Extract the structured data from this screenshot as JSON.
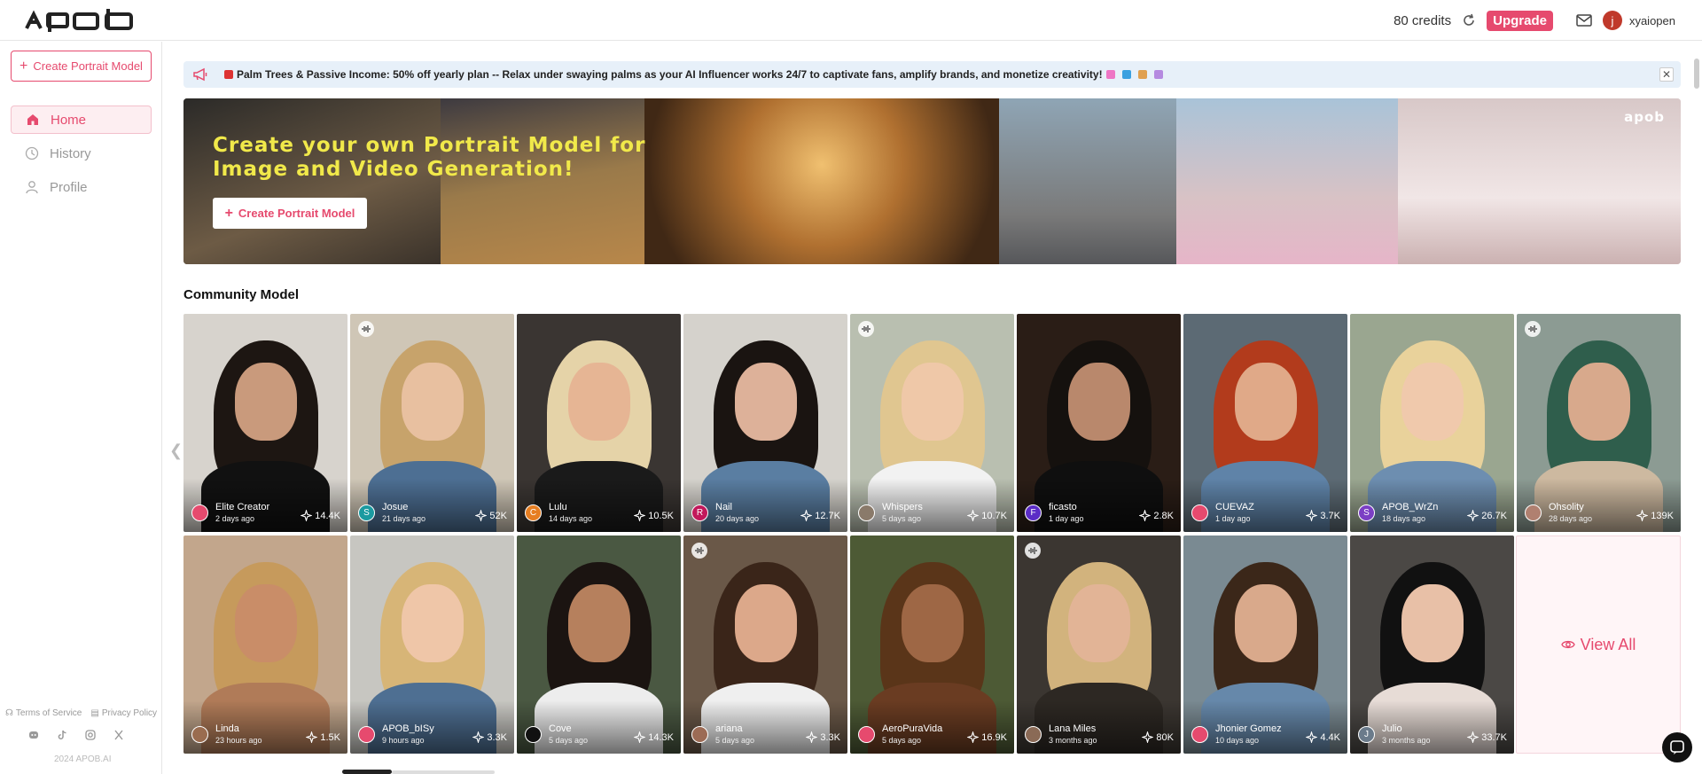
{
  "header": {
    "logo": "apob",
    "credits": "80 credits",
    "upgrade": "Upgrade",
    "avatar_letter": "j",
    "username": "xyaiopen"
  },
  "sidebar": {
    "create_label": "Create Portrait Model",
    "items": [
      {
        "label": "Home",
        "icon": "home-icon",
        "active": true
      },
      {
        "label": "History",
        "icon": "clock-icon",
        "active": false
      },
      {
        "label": "Profile",
        "icon": "user-icon",
        "active": false
      }
    ],
    "terms": "Terms of Service",
    "privacy": "Privacy Policy",
    "copyright": "2024 APOB.AI"
  },
  "announcement": {
    "text": "Palm Trees & Passive Income: 50% off yearly plan -- Relax under swaying palms as your AI Influencer works 24/7 to captivate fans, amplify brands, and monetize creativity!"
  },
  "banner": {
    "title_line1": "Create your own Portrait Model for",
    "title_line2": "Image and Video Generation!",
    "button": "Create Portrait Model",
    "logo": "apob"
  },
  "community": {
    "title": "Community Model",
    "view_all": "View All",
    "cards": [
      {
        "name": "Elite Creator",
        "time": "2 days ago",
        "stat": "14.4K",
        "av": "",
        "avColor": "#e64a6e",
        "audio": false,
        "bg": "#d7d3cd",
        "hair": "#1d1612",
        "skin": "#c99a7c",
        "body": "#111111"
      },
      {
        "name": "Josue",
        "time": "21 days ago",
        "stat": "52K",
        "av": "S",
        "avColor": "#1b9aa0",
        "audio": true,
        "bg": "#cfc6b6",
        "hair": "#c7a36b",
        "skin": "#e8c0a0",
        "body": "#4d6f93"
      },
      {
        "name": "Lulu",
        "time": "14 days ago",
        "stat": "10.5K",
        "av": "C",
        "avColor": "#e67e22",
        "audio": false,
        "bg": "#3a3532",
        "hair": "#e5d3a8",
        "skin": "#e6b594",
        "body": "#1a1a1a"
      },
      {
        "name": "Nail",
        "time": "20 days ago",
        "stat": "12.7K",
        "av": "R",
        "avColor": "#c2185b",
        "audio": false,
        "bg": "#d5d2cc",
        "hair": "#1a1411",
        "skin": "#ddb199",
        "body": "#5a7ea2"
      },
      {
        "name": "Whispers",
        "time": "5 days ago",
        "stat": "10.7K",
        "av": "",
        "avColor": "#8a7a6a",
        "audio": true,
        "bg": "#b9bfb0",
        "hair": "#e0c690",
        "skin": "#efc8a8",
        "body": "#f2f2f2"
      },
      {
        "name": "ficasto",
        "time": "1 day ago",
        "stat": "2.8K",
        "av": "F",
        "avColor": "#5b2cc6",
        "audio": false,
        "bg": "#2a1d16",
        "hair": "#15110e",
        "skin": "#b9886c",
        "body": "#0f0f0f"
      },
      {
        "name": "CUEVAZ",
        "time": "1 day ago",
        "stat": "3.7K",
        "av": "",
        "avColor": "#e64a6e",
        "audio": false,
        "bg": "#5c6a74",
        "hair": "#b23b1c",
        "skin": "#e0a988",
        "body": "#5f83a8"
      },
      {
        "name": "APOB_WrZn",
        "time": "18 days ago",
        "stat": "26.7K",
        "av": "S",
        "avColor": "#7b3fc4",
        "audio": false,
        "bg": "#9aa690",
        "hair": "#e9d29b",
        "skin": "#f0c9ac",
        "body": "#6d8eb0"
      },
      {
        "name": "Ohsolity",
        "time": "28 days ago",
        "stat": "139K",
        "av": "",
        "avColor": "#b08070",
        "audio": true,
        "bg": "#8c9b93",
        "hair": "#2f5e4c",
        "skin": "#d8a98c",
        "body": "#cdb9a0"
      },
      {
        "name": "Linda",
        "time": "23 hours ago",
        "stat": "1.5K",
        "av": "",
        "avColor": "#9a6c4f",
        "audio": false,
        "bg": "#c2a68c",
        "hair": "#c69a5c",
        "skin": "#c98d68",
        "body": "#b07b58"
      },
      {
        "name": "APOB_bISy",
        "time": "9 hours ago",
        "stat": "3.3K",
        "av": "",
        "avColor": "#e64a6e",
        "audio": false,
        "bg": "#c7c6c1",
        "hair": "#d7b577",
        "skin": "#efc6a8",
        "body": "#4e6f92"
      },
      {
        "name": "Cove",
        "time": "5 days ago",
        "stat": "14.3K",
        "av": "",
        "avColor": "#111111",
        "audio": false,
        "bg": "#4a5842",
        "hair": "#1b1411",
        "skin": "#b6805d",
        "body": "#ededed"
      },
      {
        "name": "ariana",
        "time": "5 days ago",
        "stat": "3.3K",
        "av": "",
        "avColor": "#9c6b55",
        "audio": true,
        "bg": "#6a5848",
        "hair": "#3a2519",
        "skin": "#dca88a",
        "body": "#efefef"
      },
      {
        "name": "AeroPuraVida",
        "time": "5 days ago",
        "stat": "16.9K",
        "av": "",
        "avColor": "#e64a6e",
        "audio": false,
        "bg": "#4d5a35",
        "hair": "#5a3519",
        "skin": "#9e6745",
        "body": "#6a3c22"
      },
      {
        "name": "Lana Miles",
        "time": "3 months ago",
        "stat": "80K",
        "av": "",
        "avColor": "#8a6a56",
        "audio": true,
        "bg": "#3b3631",
        "hair": "#d2b37d",
        "skin": "#e2b496",
        "body": "#2d2823"
      },
      {
        "name": "Jhonier Gomez",
        "time": "10 days ago",
        "stat": "4.4K",
        "av": "",
        "avColor": "#e64a6e",
        "audio": false,
        "bg": "#7a8a92",
        "hair": "#3b2719",
        "skin": "#d9a98b",
        "body": "#6688aa"
      },
      {
        "name": "Julio",
        "time": "3 months ago",
        "stat": "33.7K",
        "av": "J",
        "avColor": "#6b7b8b",
        "audio": false,
        "bg": "#4b4845",
        "hair": "#111111",
        "skin": "#e8c0a7",
        "body": "#e7dcd6"
      }
    ]
  }
}
